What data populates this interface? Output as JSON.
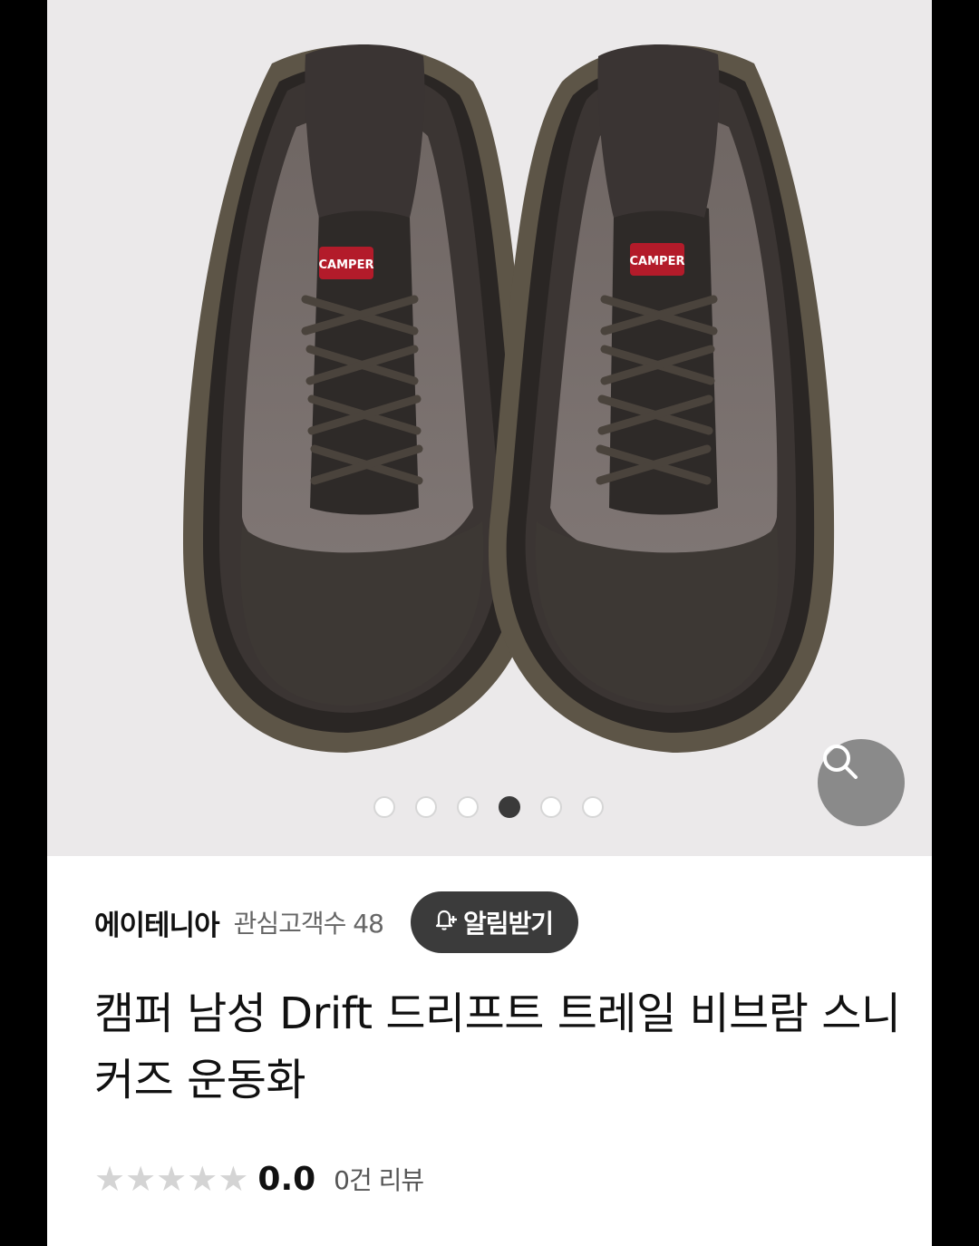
{
  "product_image": {
    "description_label": "CAMPER",
    "carousel": {
      "total": 6,
      "active_index": 3
    }
  },
  "seller": {
    "name": "에이테니아",
    "followers_label": "관심고객수 48",
    "notify_label": "알림받기"
  },
  "product": {
    "title": "캠퍼 남성 Drift 드리프트 트레일 비브람 스니커즈 운동화"
  },
  "rating": {
    "stars_filled": 0,
    "stars_total": 5,
    "score": "0.0",
    "reviews_label": "0건 리뷰"
  },
  "colors": {
    "background": "#ebe9ea",
    "button_dark": "#3b3b3b",
    "zoom_button": "#8a8a8a",
    "star_empty": "#d4d4d4"
  }
}
